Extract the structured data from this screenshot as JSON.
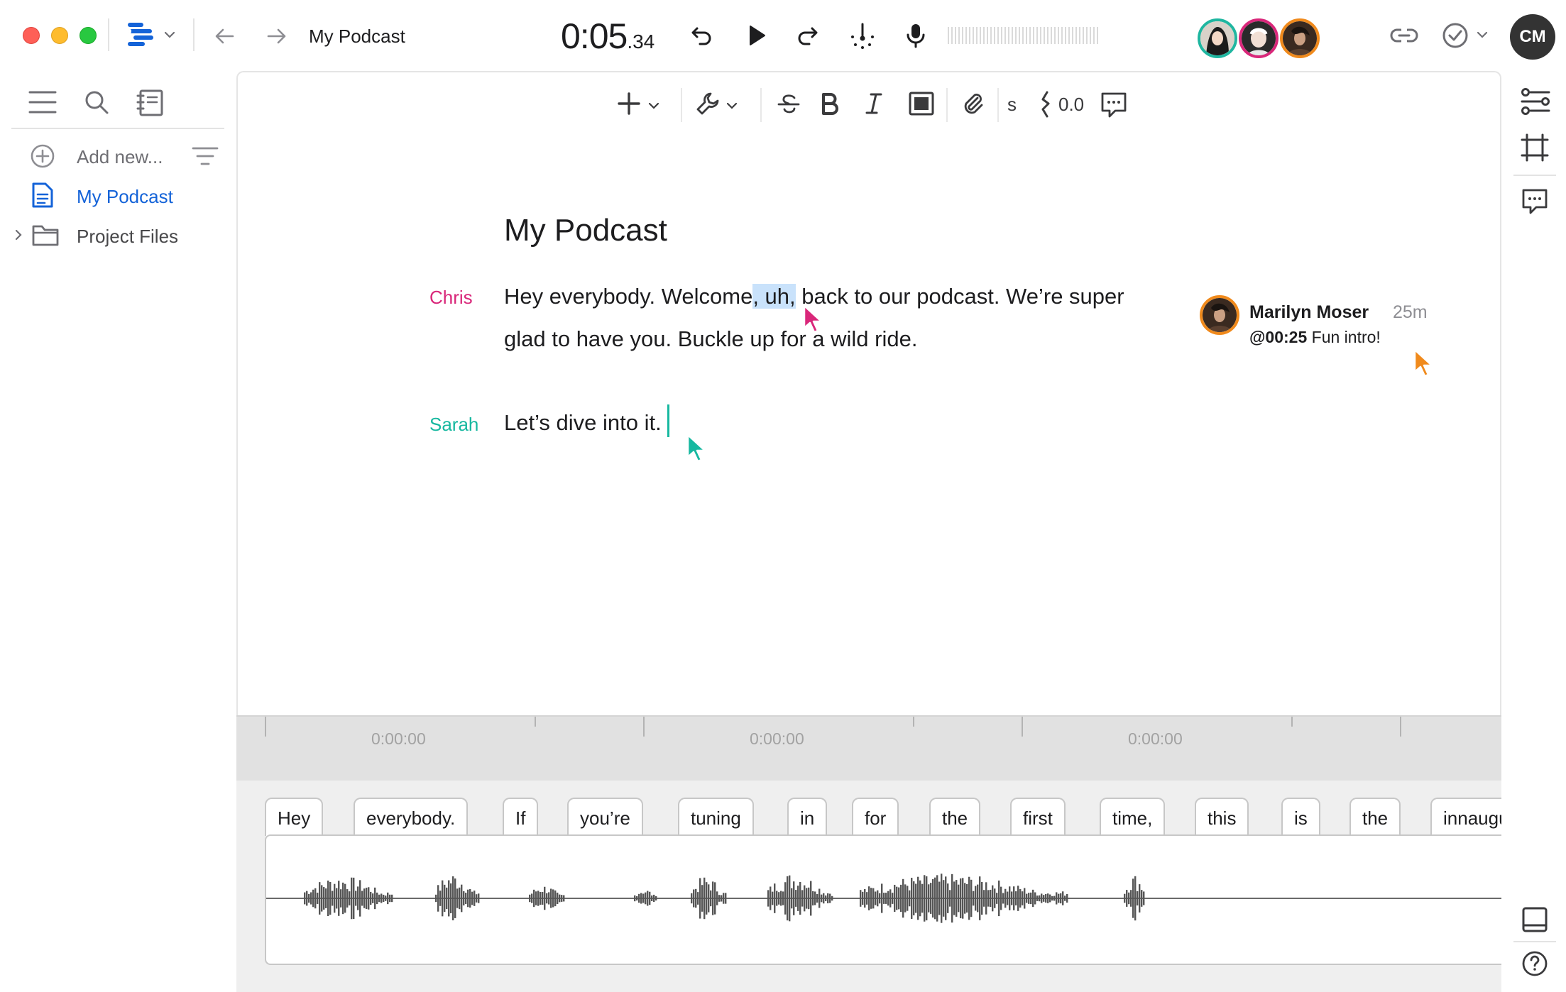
{
  "window": {
    "title": "My Podcast",
    "timer_main": "0:05",
    "timer_fraction": ".34"
  },
  "toolbar": {
    "icons": [
      "app-logo-icon",
      "chevron-down-icon",
      "back-arrow-icon",
      "forward-arrow-icon",
      "rewind-icon",
      "play-icon",
      "forward-skip-icon",
      "marker-icon",
      "microphone-icon",
      "link-icon",
      "check-circle-icon"
    ],
    "collaborators": [
      {
        "ring": "#1fb6a0"
      },
      {
        "ring": "#d9277a"
      },
      {
        "ring": "#f08a1c"
      }
    ],
    "user_initials": "CM"
  },
  "sidebar": {
    "items": [
      {
        "label": "Add new...",
        "icon": "plus-circle-icon"
      },
      {
        "label": "My Podcast",
        "icon": "document-icon",
        "active": true
      },
      {
        "label": "Project Files",
        "icon": "folder-icon"
      }
    ]
  },
  "format_bar": {
    "strike_label": "s",
    "gap_value": "0.0"
  },
  "document": {
    "heading": "My Podcast",
    "paragraphs": [
      {
        "speaker": "Chris",
        "speaker_color": "#d9277a",
        "text_before": "Hey everybody. Welcome",
        "highlight": ", uh,",
        "text_after": " back to our podcast. We’re super glad to have you. Buckle up for a wild ride."
      },
      {
        "speaker": "Sarah",
        "speaker_color": "#17b8a0",
        "text": "Let’s dive into it."
      }
    ],
    "comment": {
      "author": "Marilyn Moser",
      "time": "25m",
      "timestamp": "@00:25",
      "text": " Fun intro!"
    }
  },
  "timeline": {
    "ruler_labels": [
      "0:00:00",
      "0:00:00",
      "0:00:00"
    ],
    "words": [
      "Hey",
      "everybody.",
      "If",
      "you’re",
      "tuning",
      "in",
      "for",
      "the",
      "first",
      "time,",
      "this",
      "is",
      "the",
      "innaugural"
    ]
  },
  "colors": {
    "accent": "#1463d8",
    "chris": "#d9277a",
    "sarah": "#17b8a0",
    "marilyn": "#f08a1c",
    "highlight": "#c9e2fb"
  }
}
